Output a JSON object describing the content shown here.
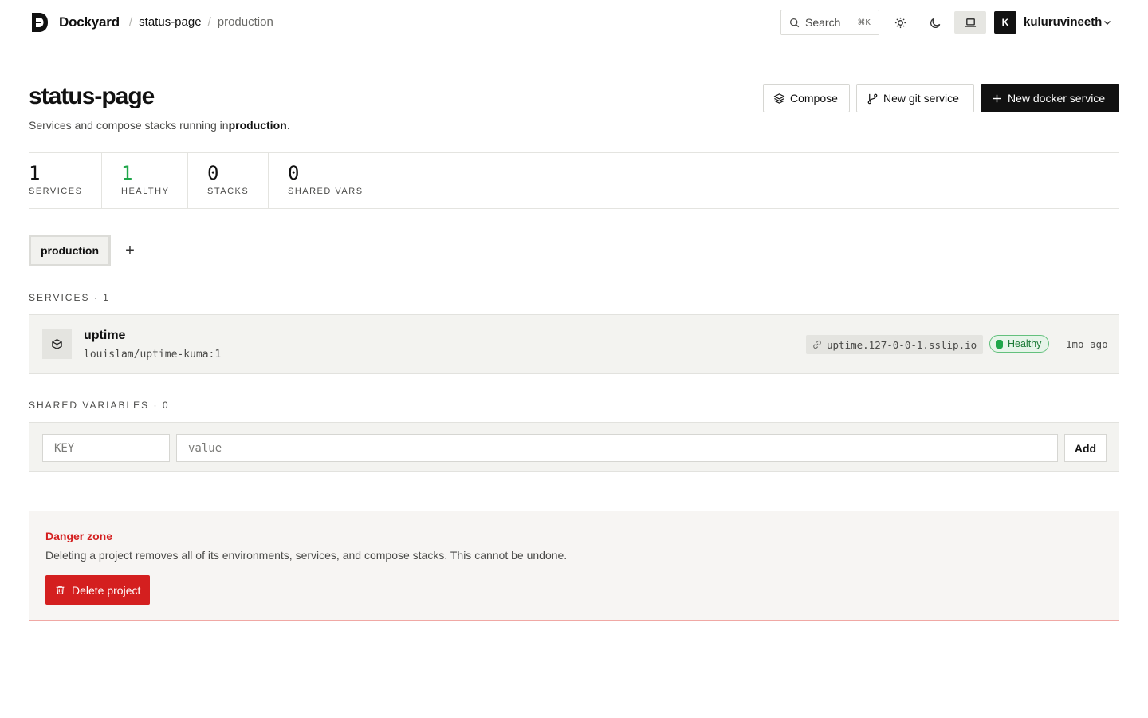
{
  "topbar": {
    "brand": "Dockyard",
    "breadcrumb": [
      "status-page",
      "production"
    ],
    "search_label": "Search",
    "search_shortcut": "⌘K",
    "user_initial": "K",
    "username": "kuluruvineeth"
  },
  "header": {
    "title": "status-page",
    "subtitle_prefix": "Services and compose stacks running in",
    "subtitle_env": "production",
    "subtitle_suffix": ".",
    "compose_label": "Compose",
    "git_label": "New git service",
    "docker_label": "New docker service"
  },
  "stats": [
    {
      "value": "1",
      "label": "SERVICES"
    },
    {
      "value": "1",
      "label": "HEALTHY"
    },
    {
      "value": "0",
      "label": "STACKS"
    },
    {
      "value": "0",
      "label": "SHARED VARS"
    }
  ],
  "environments": {
    "tabs": [
      "production"
    ],
    "add_label": "+"
  },
  "services": {
    "section_label": "SERVICES · 1",
    "items": [
      {
        "name": "uptime",
        "image": "louislam/uptime-kuma:1",
        "domain": "uptime.127-0-0-1.sslip.io",
        "status": "Healthy",
        "updated": "1mo ago"
      }
    ]
  },
  "shared_vars": {
    "section_label": "SHARED VARIABLES · 0",
    "key_placeholder": "KEY",
    "value_placeholder": "value",
    "add_label": "Add"
  },
  "danger": {
    "title": "Danger zone",
    "text": "Deleting a project removes all of its environments, services, and compose stacks. This cannot be undone.",
    "button_label": "Delete project"
  },
  "colors": {
    "accent": "#111111",
    "healthy": "#1fa64a",
    "danger": "#d41f1f"
  }
}
